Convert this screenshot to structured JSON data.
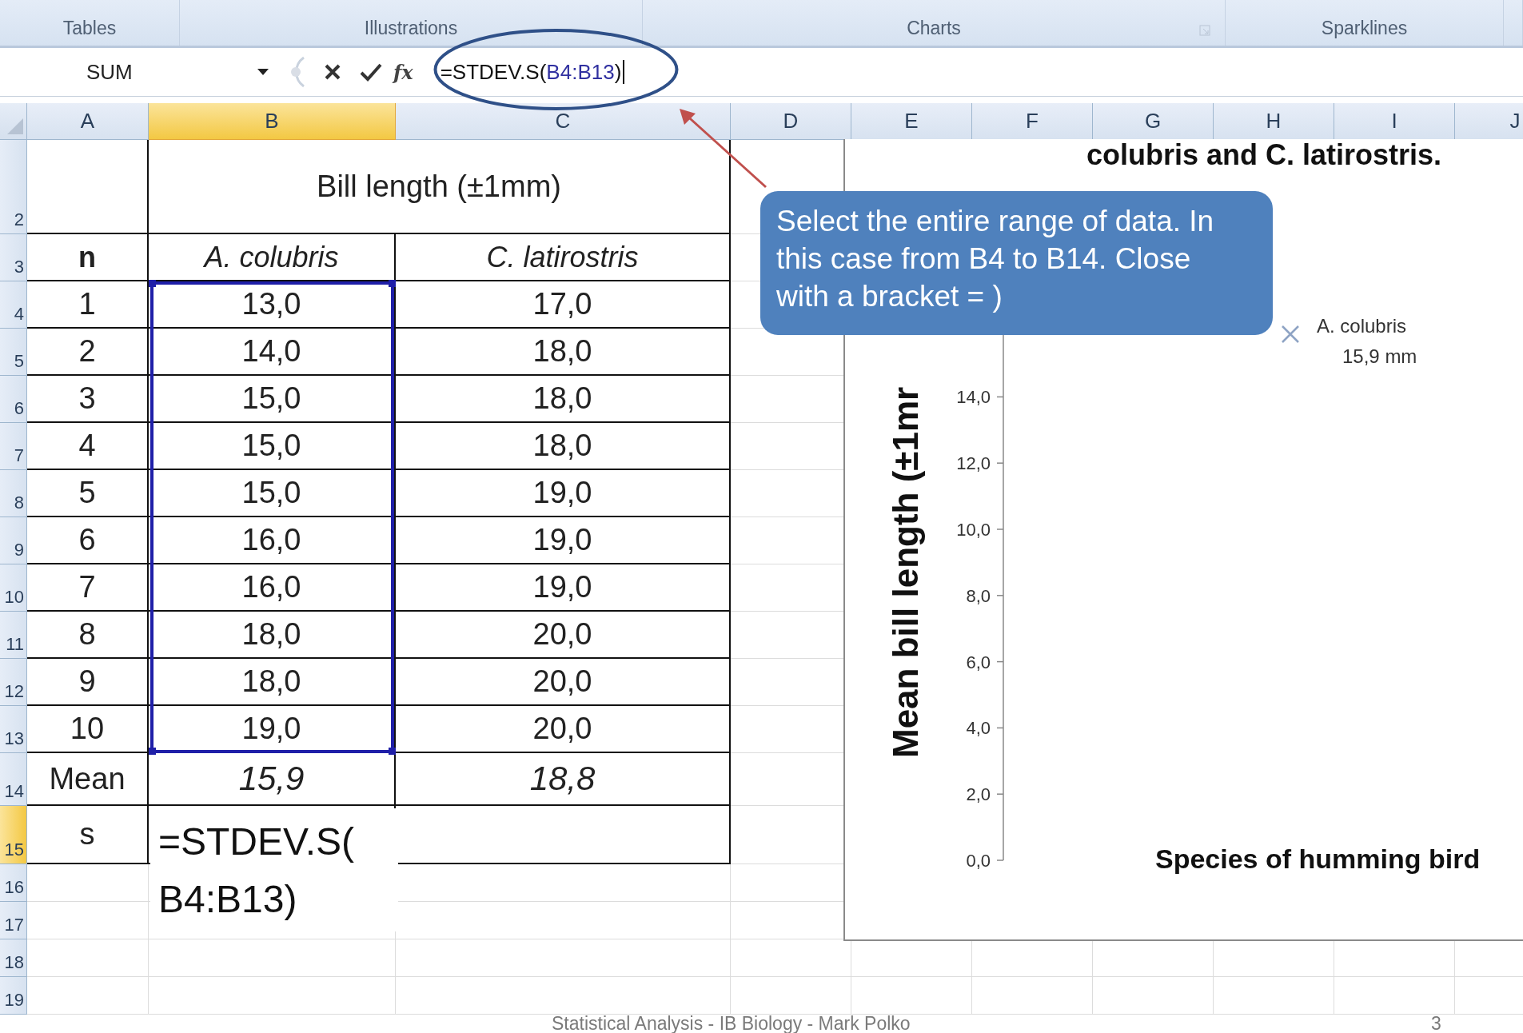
{
  "ribbon_groups": [
    {
      "label": "Tables",
      "launcher": false
    },
    {
      "label": "Illustrations",
      "launcher": false
    },
    {
      "label": "Charts",
      "launcher": true
    },
    {
      "label": "Sparklines",
      "launcher": false
    }
  ],
  "formula_bar": {
    "name_box": "SUM",
    "function_button": "fx",
    "formula": {
      "prefix": "=STDEV.S(",
      "reference": "B4:B13",
      "suffix": ")"
    }
  },
  "columns": [
    {
      "label": "A",
      "selected": false
    },
    {
      "label": "B",
      "selected": true
    },
    {
      "label": "C",
      "selected": false
    },
    {
      "label": "D",
      "selected": false
    },
    {
      "label": "E",
      "selected": false
    },
    {
      "label": "F",
      "selected": false
    },
    {
      "label": "G",
      "selected": false
    },
    {
      "label": "H",
      "selected": false
    },
    {
      "label": "I",
      "selected": false
    },
    {
      "label": "J",
      "selected": false
    }
  ],
  "row_headers": [
    {
      "label": "2",
      "selected": false
    },
    {
      "label": "3",
      "selected": false
    },
    {
      "label": "4",
      "selected": false
    },
    {
      "label": "5",
      "selected": false
    },
    {
      "label": "6",
      "selected": false
    },
    {
      "label": "7",
      "selected": false
    },
    {
      "label": "8",
      "selected": false
    },
    {
      "label": "9",
      "selected": false
    },
    {
      "label": "10",
      "selected": false
    },
    {
      "label": "11",
      "selected": false
    },
    {
      "label": "12",
      "selected": false
    },
    {
      "label": "13",
      "selected": false
    },
    {
      "label": "14",
      "selected": false
    },
    {
      "label": "15",
      "selected": true
    },
    {
      "label": "16",
      "selected": false
    },
    {
      "label": "17",
      "selected": false
    },
    {
      "label": "18",
      "selected": false
    },
    {
      "label": "19",
      "selected": false
    }
  ],
  "table": {
    "title": "Bill length (±1mm)",
    "headers": [
      "n",
      "A. colubris",
      "C. latirostris"
    ],
    "rows": [
      [
        "1",
        "13,0",
        "17,0"
      ],
      [
        "2",
        "14,0",
        "18,0"
      ],
      [
        "3",
        "15,0",
        "18,0"
      ],
      [
        "4",
        "15,0",
        "18,0"
      ],
      [
        "5",
        "15,0",
        "19,0"
      ],
      [
        "6",
        "16,0",
        "19,0"
      ],
      [
        "7",
        "16,0",
        "19,0"
      ],
      [
        "8",
        "18,0",
        "20,0"
      ],
      [
        "9",
        "18,0",
        "20,0"
      ],
      [
        "10",
        "19,0",
        "20,0"
      ]
    ],
    "mean": {
      "label": "Mean",
      "values": [
        "15,9",
        "18,8"
      ]
    },
    "sd": {
      "label": "s",
      "editing_lines": [
        "=STDEV.S(",
        "B4:B13)"
      ]
    }
  },
  "chart": {
    "title": "colubris  and C. latirostris.",
    "x_axis_title": "Species of humming bird",
    "y_axis_title": "Mean bill length (±1mr",
    "y_tick_labels": [
      "14,0",
      "12,0",
      "10,0",
      "8,0",
      "6,0",
      "4,0",
      "2,0",
      "0,0"
    ],
    "points": [
      {
        "name": "A. colubris",
        "value_label": "15,9 mm",
        "color": "#8ea3c4"
      }
    ]
  },
  "callout": "Select the entire range of data. In this case from B4 to B14. Close with a bracket = )",
  "footer": {
    "text": "Statistical Analysis - IB Biology - Mark Polko",
    "page": "3"
  }
}
